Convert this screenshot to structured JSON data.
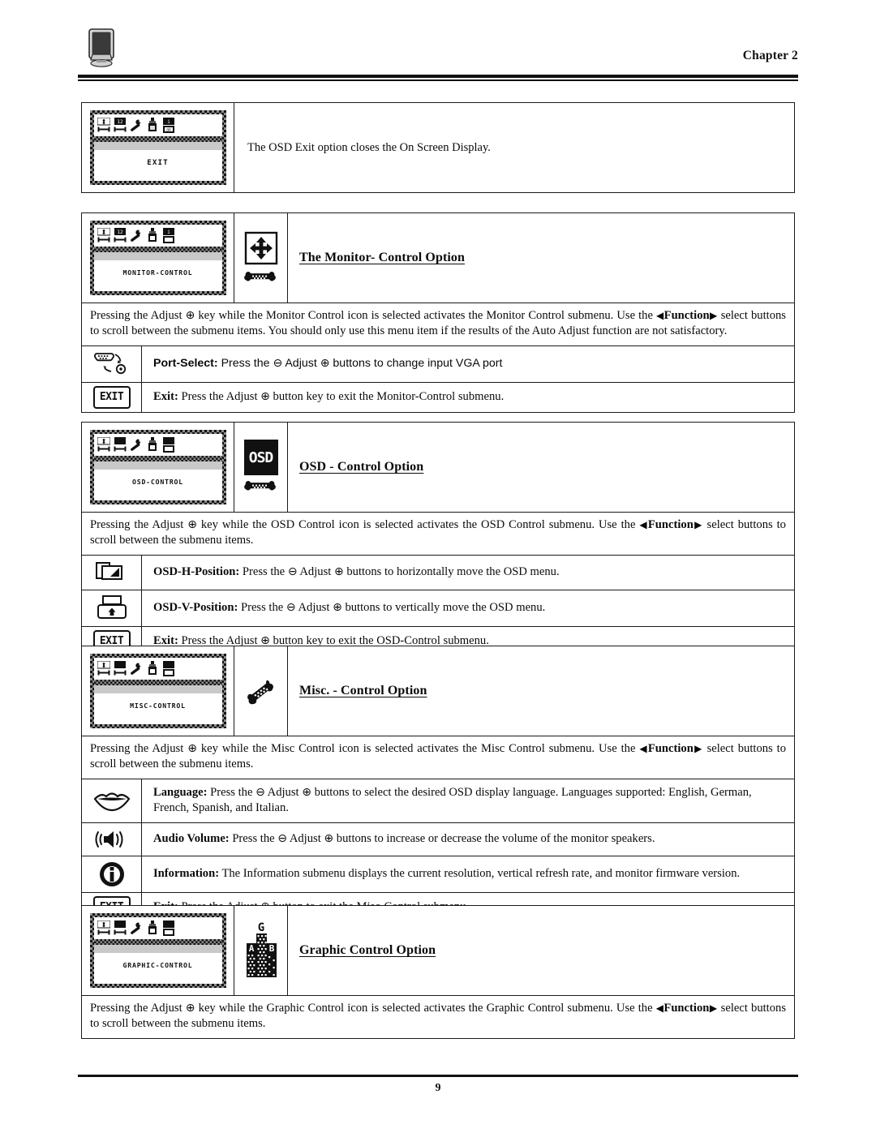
{
  "header": {
    "chapter": "Chapter 2",
    "logo_icon": "monitor-icon"
  },
  "footer": {
    "page_number": "9"
  },
  "symbols": {
    "plus": "⊕",
    "minus": "⊖",
    "left_arrow": "◀",
    "right_arrow": "▶",
    "function_word": "Function"
  },
  "osd_menu_icons": [
    "geometry-icon",
    "size-icon",
    "wrench-icon",
    "lamp-icon",
    "info-icon"
  ],
  "sections": [
    {
      "id": "exit",
      "osd_label": "EXIT",
      "description": "The OSD Exit option closes the On Screen Display."
    },
    {
      "id": "monitor-control",
      "osd_label": "MONITOR-CONTROL",
      "icon": "four-way-arrow-icon",
      "sub_icon": "bone-icon",
      "title": "The Monitor- Control Option",
      "paragraph_pre": "Pressing the Adjust ",
      "paragraph_mid": " key while the Monitor Control icon is selected activates the Monitor Control submenu.  Use the ",
      "paragraph_post": " select buttons to scroll between the submenu items.  You should only use this menu item if the results of the Auto Adjust function are not satisfactory.",
      "rows": [
        {
          "icon": "port-select-icon",
          "label": "Port-Select:",
          "text_a": " Press the ",
          "text_b": " Adjust ",
          "text_c": " buttons to change input VGA port",
          "style": "sans"
        },
        {
          "icon": "exit-icon",
          "label": "Exit:",
          "text_a": " Press the Adjust ",
          "text_b": " button key to exit the Monitor-Control submenu.",
          "style": "serif"
        }
      ]
    },
    {
      "id": "osd-control",
      "osd_label": "OSD-CONTROL",
      "icon": "osd-box-icon",
      "icon_text": "OSD",
      "sub_icon": "bone-icon",
      "title": "OSD - Control Option",
      "paragraph_pre": "Pressing the Adjust ",
      "paragraph_mid": " key while the OSD Control icon is selected activates the OSD Control submenu.  Use the ",
      "paragraph_post": " select buttons to scroll between the submenu items.",
      "rows": [
        {
          "icon": "h-position-icon",
          "label": "OSD-H-Position:",
          "text_a": " Press the ",
          "text_b": " Adjust ",
          "text_c": " buttons to horizontally move the OSD menu.",
          "style": "serif-dual"
        },
        {
          "icon": "v-position-icon",
          "label": "OSD-V-Position:",
          "text_a": " Press the ",
          "text_b": " Adjust ",
          "text_c": " buttons to vertically move the OSD menu.",
          "style": "serif-dual"
        },
        {
          "icon": "exit-icon",
          "label": "Exit:",
          "text_a": " Press the Adjust ",
          "text_b": " button key to exit the OSD-Control submenu.",
          "style": "serif"
        }
      ]
    },
    {
      "id": "misc-control",
      "osd_label": "MISC-CONTROL",
      "icon": "wrench-diagonal-icon",
      "title": "Misc. - Control Option",
      "paragraph_pre": "Pressing the Adjust ",
      "paragraph_mid": " key while the Misc Control icon is selected activates the Misc Control submenu.  Use the ",
      "paragraph_post": " select buttons to scroll between the submenu items.",
      "rows": [
        {
          "icon": "lips-icon",
          "label": "Language:",
          "text_a": " Press the ",
          "text_b": " Adjust ",
          "text_c": " buttons to select the desired OSD display language.  Languages supported:  English, German, French, Spanish, and Italian.",
          "style": "serif-dual"
        },
        {
          "icon": "speaker-icon",
          "label": "Audio Volume:",
          "text_a": " Press the ",
          "text_b": " Adjust ",
          "text_c": " buttons to increase or decrease the volume of the monitor speakers.",
          "style": "serif-dual"
        },
        {
          "icon": "information-icon",
          "label": "Information:",
          "text_a": " The Information submenu displays the current resolution, vertical refresh rate, and monitor firmware version.",
          "style": "plain"
        },
        {
          "icon": "exit-icon",
          "label": "Exit:",
          "text_a": " Press the Adjust ",
          "text_b": " button to exit the Misc-Control submenu.",
          "style": "serif"
        }
      ]
    },
    {
      "id": "graphic-control",
      "osd_label": "GRAPHIC-CONTROL",
      "icon": "graphic-bars-icon",
      "icon_letters": [
        "G",
        "A",
        "B"
      ],
      "title": "Graphic Control Option",
      "paragraph_pre": "Pressing the Adjust ",
      "paragraph_mid": " key while the Graphic Control icon is selected activates the Graphic Control submenu.  Use the ",
      "paragraph_post": " select buttons to scroll between the submenu items.",
      "rows": []
    }
  ]
}
